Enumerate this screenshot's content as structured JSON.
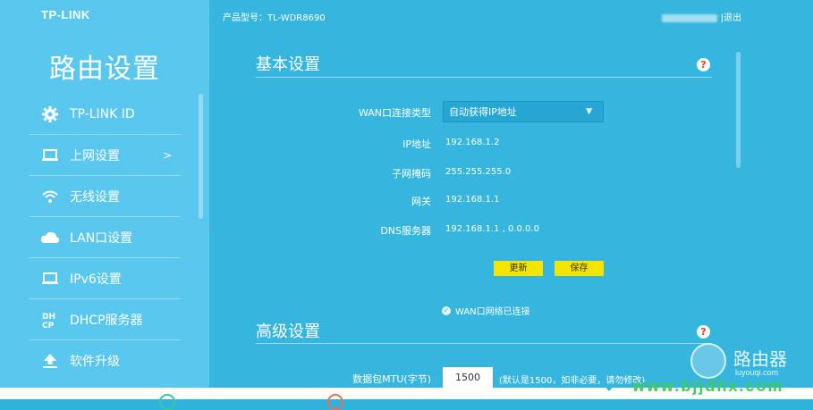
{
  "brand": "TP-LINK",
  "sidebar": {
    "title": "路由设置",
    "items": [
      {
        "label": "TP-LINK ID",
        "icon": "gear-icon"
      },
      {
        "label": "上网设置",
        "icon": "laptop-icon",
        "arrow": ">"
      },
      {
        "label": "无线设置",
        "icon": "wifi-icon"
      },
      {
        "label": "LAN口设置",
        "icon": "cloud-icon"
      },
      {
        "label": "IPv6设置",
        "icon": "laptop-icon"
      },
      {
        "label": "DHCP服务器",
        "icon": "dhcp-icon",
        "icon_text": "DH CP"
      },
      {
        "label": "软件升级",
        "icon": "upload-icon"
      }
    ]
  },
  "topbar": {
    "model": "产品型号：TL-WDR8690",
    "logout": "|退出"
  },
  "basic": {
    "title": "基本设置",
    "help": "?",
    "wan_type_label": "WAN口连接类型",
    "wan_type_value": "自动获得IP地址",
    "ip_label": "IP地址",
    "ip_value": "192.168.1.2",
    "mask_label": "子网掩码",
    "mask_value": "255.255.255.0",
    "gateway_label": "网关",
    "gateway_value": "192.168.1.1",
    "dns_label": "DNS服务器",
    "dns_value": "192.168.1.1 , 0.0.0.0",
    "renew_btn": "更新",
    "save_btn": "保存",
    "status": "WAN口网络已连接"
  },
  "advanced": {
    "title": "高级设置",
    "help": "?",
    "mtu_label": "数据包MTU(字节)",
    "mtu_value": "1500",
    "mtu_hint": "(默认是1500，如非必要，请勿修改)"
  },
  "watermark": {
    "name": "路由器",
    "url": "luyouqi.com",
    "bottom": "www.bjjdhx.com"
  }
}
